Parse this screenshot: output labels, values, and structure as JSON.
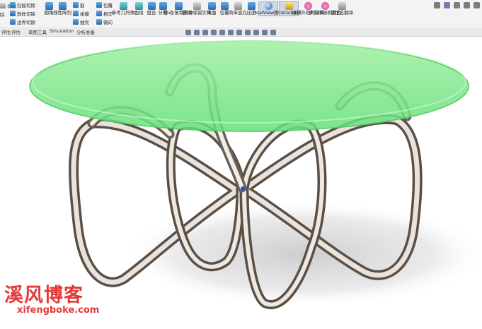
{
  "ribbon": {
    "left_labels": [
      "扫描切除",
      "放样切除",
      "边界切除"
    ],
    "left_small": [
      "切除",
      "除"
    ],
    "groups": [
      {
        "label": "圆角"
      },
      {
        "label": "线性阵列"
      },
      {
        "label": "筋"
      },
      {
        "label": "拔模"
      },
      {
        "label": "抽壳"
      },
      {
        "label": "包覆"
      },
      {
        "label": "相交"
      },
      {
        "label": "镜向"
      },
      {
        "label": "参考几何体"
      },
      {
        "label": "曲线"
      },
      {
        "label": "组合"
      },
      {
        "label": "分割"
      },
      {
        "label": "移动/复制实体"
      },
      {
        "label": "删除/保留实体"
      },
      {
        "label": "弯曲"
      },
      {
        "label": "包覆"
      },
      {
        "label": "简单直孔"
      },
      {
        "label": "压凹"
      },
      {
        "label": "RealView图形"
      },
      {
        "label": "Instant3D"
      },
      {
        "label": "编辑外观的装饰"
      },
      {
        "label": "多实体随机颜色"
      },
      {
        "label": "特征名翻译"
      }
    ]
  },
  "tabs": [
    "评估",
    "评估",
    "草图工具",
    "Simulation",
    "分析准备"
  ],
  "watermark": {
    "cn": "溪风博客",
    "url": "xifengboke.com"
  }
}
